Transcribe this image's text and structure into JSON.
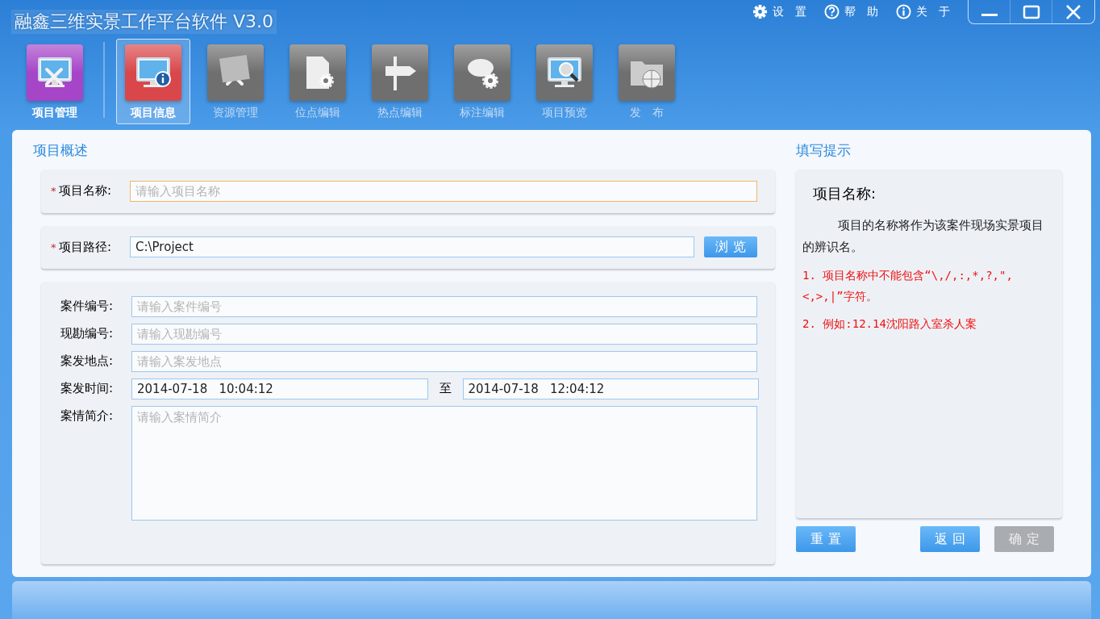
{
  "window": {
    "title": "融鑫三维实景工作平台软件 V3.0"
  },
  "top_menu": [
    {
      "kind": "gear",
      "label": "设　置"
    },
    {
      "kind": "help",
      "label": "帮　助"
    },
    {
      "kind": "info",
      "label": "关　于"
    }
  ],
  "tabs": [
    {
      "kind": "monitor-tools",
      "label": "项目管理",
      "color": "#a645c8",
      "selected": false,
      "disabled": false
    },
    {
      "kind": "monitor-info",
      "label": "项目信息",
      "color": "#d9474a",
      "selected": true,
      "disabled": false
    },
    {
      "kind": "tools",
      "label": "资源管理",
      "color": "#6f6f6f",
      "selected": false,
      "disabled": true
    },
    {
      "kind": "document-gear",
      "label": "位点编辑",
      "color": "#6f6f6f",
      "selected": false,
      "disabled": true
    },
    {
      "kind": "signpost",
      "label": "热点编辑",
      "color": "#6f6f6f",
      "selected": false,
      "disabled": true
    },
    {
      "kind": "speech-gear",
      "label": "标注编辑",
      "color": "#6f6f6f",
      "selected": false,
      "disabled": true
    },
    {
      "kind": "monitor-magnifier",
      "label": "项目预览",
      "color": "#6f6f6f",
      "selected": false,
      "disabled": true
    },
    {
      "kind": "folder-globe",
      "label": "发　布",
      "color": "#6f6f6f",
      "selected": false,
      "disabled": true
    }
  ],
  "overview": {
    "title": "项目概述",
    "name_field": {
      "marker": "*",
      "label": "项目名称:",
      "placeholder": "请输入项目名称",
      "focused": true
    },
    "path_field": {
      "marker": "*",
      "label": "项目路径:",
      "value": "C:\\Project",
      "button": "浏 览"
    },
    "details": [
      {
        "kind": "text",
        "label": "案件编号:",
        "placeholder": "请输入案件编号"
      },
      {
        "kind": "text",
        "label": "现勘编号:",
        "placeholder": "请输入现勘编号"
      },
      {
        "kind": "text",
        "label": "案发地点:",
        "placeholder": "请输入案发地点"
      },
      {
        "kind": "range",
        "label": "案发时间:",
        "from": "2014-07-18   10:04:12",
        "separator": "至",
        "to": "2014-07-18   12:04:12"
      },
      {
        "kind": "textarea",
        "label": "案情简介:",
        "placeholder": "请输入案情简介"
      }
    ]
  },
  "tips": {
    "title": "填写提示",
    "heading": "项目名称:",
    "body": "项目的名称将作为该案件现场实景项目的辨识名。",
    "rules": [
      "1. 项目名称中不能包含“\\,/,:,*,?,\",<,>,|”字符。",
      "2. 例如:12.14沈阳路入室杀人案"
    ]
  },
  "buttons": [
    {
      "label": "重 置",
      "disabled": false
    },
    {
      "label": "返 回",
      "disabled": false
    },
    {
      "label": "确 定",
      "disabled": true
    }
  ]
}
